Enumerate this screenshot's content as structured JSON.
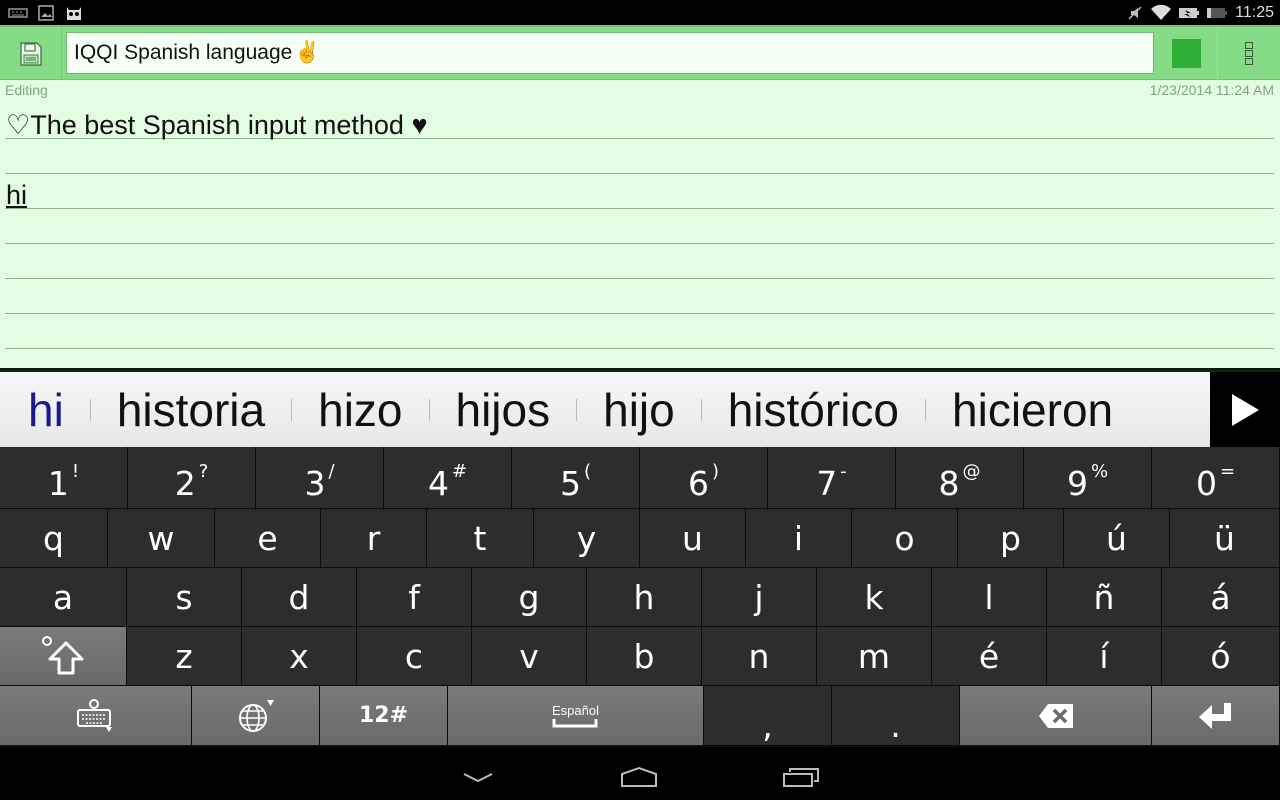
{
  "status_bar": {
    "left_icons": [
      "keyboard-icon",
      "image-icon",
      "cyanogen-icon"
    ],
    "right_icons": [
      "mute-icon",
      "wifi-icon",
      "battery-charging-icon",
      "battery-icon"
    ],
    "battery_level": "21",
    "time": "11:25"
  },
  "toolbar": {
    "save_icon": "floppy-disk-icon",
    "title": "IQQI Spanish language",
    "title_emoji": "✌",
    "color_swatch": "#2fae38",
    "menu_icon": "overflow-menu-icon"
  },
  "editor": {
    "status": "Editing",
    "date": "1/23/2014 11:24 AM",
    "lines": [
      {
        "text": "♡The best Spanish input method ♥",
        "underlined": false
      },
      {
        "text": "",
        "underlined": false
      },
      {
        "text": "hi",
        "underlined": true
      }
    ],
    "background": "#e2fde2"
  },
  "candidates": {
    "items": [
      "hi",
      "historia",
      "hizo",
      "hijos",
      "hijo",
      "histórico",
      "hicieron"
    ],
    "more_icon": "play-arrow-icon"
  },
  "keyboard": {
    "number_row": [
      {
        "main": "1",
        "alt": "!"
      },
      {
        "main": "2",
        "alt": "?"
      },
      {
        "main": "3",
        "alt": "/"
      },
      {
        "main": "4",
        "alt": "#"
      },
      {
        "main": "5",
        "alt": "("
      },
      {
        "main": "6",
        "alt": ")"
      },
      {
        "main": "7",
        "alt": "-"
      },
      {
        "main": "8",
        "alt": "@"
      },
      {
        "main": "9",
        "alt": "%"
      },
      {
        "main": "0",
        "alt": "="
      }
    ],
    "row1": [
      "q",
      "w",
      "e",
      "r",
      "t",
      "y",
      "u",
      "i",
      "o",
      "p",
      "ú",
      "ü"
    ],
    "row2": [
      "a",
      "s",
      "d",
      "f",
      "g",
      "h",
      "j",
      "k",
      "l",
      "ñ",
      "á"
    ],
    "row3": [
      "z",
      "x",
      "c",
      "v",
      "b",
      "n",
      "m",
      "é",
      "í",
      "ó"
    ],
    "shift_icon": "shift-icon",
    "bottom_row": {
      "settings_icon": "keyboard-settings-icon",
      "language_icon": "globe-icon",
      "symbols_label": "12#",
      "space_label": "Español",
      "comma": ",",
      "period": ".",
      "backspace_icon": "backspace-icon",
      "enter_icon": "enter-icon"
    }
  },
  "nav_bar": {
    "back_icon": "back-chevron-icon",
    "home_icon": "home-icon",
    "recents_icon": "recents-icon"
  }
}
